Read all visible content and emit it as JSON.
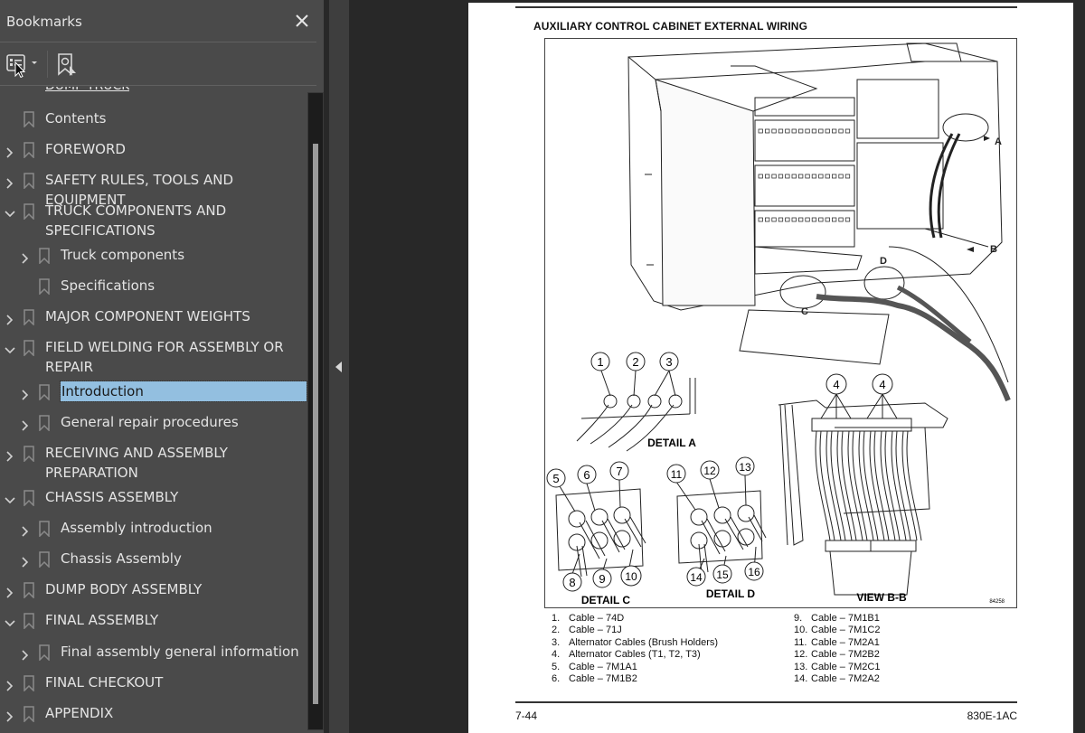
{
  "sidebar": {
    "title": "Bookmarks",
    "close_icon": "close-icon",
    "toolbar": {
      "options_icon": "bookmark-options-icon",
      "options_dropdown_icon": "caret-down-icon",
      "find_current_icon": "find-current-bookmark-icon"
    },
    "partial_top_item": "DUMP TRUCK",
    "items": [
      {
        "label": "Contents",
        "level": 0,
        "expander": "none"
      },
      {
        "label": "FOREWORD",
        "level": 0,
        "expander": "collapsed"
      },
      {
        "label": "SAFETY RULES, TOOLS AND EQUIPMENT",
        "level": 0,
        "expander": "collapsed"
      },
      {
        "label": "TRUCK COMPONENTS AND SPECIFICATIONS",
        "level": 0,
        "expander": "expanded"
      },
      {
        "label": "Truck components",
        "level": 1,
        "expander": "collapsed"
      },
      {
        "label": "Specifications",
        "level": 1,
        "expander": "none"
      },
      {
        "label": "MAJOR COMPONENT WEIGHTS",
        "level": 0,
        "expander": "collapsed"
      },
      {
        "label": "FIELD WELDING FOR ASSEMBLY OR REPAIR",
        "level": 0,
        "expander": "expanded"
      },
      {
        "label": "Introduction",
        "level": 1,
        "expander": "collapsed",
        "selected": true
      },
      {
        "label": "General repair procedures",
        "level": 1,
        "expander": "collapsed"
      },
      {
        "label": "RECEIVING AND ASSEMBLY PREPARATION",
        "level": 0,
        "expander": "collapsed"
      },
      {
        "label": "CHASSIS ASSEMBLY",
        "level": 0,
        "expander": "expanded"
      },
      {
        "label": "Assembly introduction",
        "level": 1,
        "expander": "collapsed"
      },
      {
        "label": "Chassis Assembly",
        "level": 1,
        "expander": "collapsed"
      },
      {
        "label": "DUMP BODY ASSEMBLY",
        "level": 0,
        "expander": "collapsed"
      },
      {
        "label": "FINAL ASSEMBLY",
        "level": 0,
        "expander": "expanded"
      },
      {
        "label": "Final assembly general information",
        "level": 1,
        "expander": "collapsed"
      },
      {
        "label": "FINAL CHECKOUT",
        "level": 0,
        "expander": "collapsed"
      },
      {
        "label": "APPENDIX",
        "level": 0,
        "expander": "collapsed"
      }
    ],
    "scroll_position_fraction": 0.12,
    "colors": {
      "panel": "#4a4a4a",
      "selected": "#93bfe0",
      "text": "#e4e4e4"
    }
  },
  "collapse_panel_icon": "collapse-left-icon",
  "page": {
    "figure_title": "AUXILIARY CONTROL CABINET EXTERNAL WIRING",
    "figure_id": "84258",
    "callouts": {
      "view_letters": [
        "A",
        "B",
        "C",
        "D"
      ],
      "detail_a": {
        "caption": "DETAIL A",
        "numbers": [
          "1",
          "2",
          "3"
        ]
      },
      "detail_c": {
        "caption": "DETAIL C",
        "numbers": [
          "5",
          "6",
          "7",
          "8",
          "9",
          "10"
        ]
      },
      "detail_d": {
        "caption": "DETAIL D",
        "numbers": [
          "11",
          "12",
          "13",
          "14",
          "15",
          "16"
        ]
      },
      "view_bb": {
        "caption": "VIEW B-B",
        "numbers": [
          "4",
          "4"
        ]
      }
    },
    "legend_left": [
      {
        "num": "1.",
        "text": "Cable – 74D"
      },
      {
        "num": "2.",
        "text": "Cable – 71J"
      },
      {
        "num": "3.",
        "text": "Alternator Cables (Brush Holders)"
      },
      {
        "num": "4.",
        "text": "Alternator Cables (T1, T2, T3)"
      },
      {
        "num": "5.",
        "text": "Cable – 7M1A1"
      },
      {
        "num": "6.",
        "text": "Cable – 7M1B2"
      }
    ],
    "legend_right": [
      {
        "num": "9.",
        "text": "Cable – 7M1B1"
      },
      {
        "num": "10.",
        "text": "Cable – 7M1C2"
      },
      {
        "num": "11.",
        "text": "Cable – 7M2A1"
      },
      {
        "num": "12.",
        "text": "Cable – 7M2B2"
      },
      {
        "num": "13.",
        "text": "Cable – 7M2C1"
      },
      {
        "num": "14.",
        "text": "Cable – 7M2A2"
      }
    ],
    "footer_page": "7-44",
    "footer_doc": "830E-1AC"
  }
}
